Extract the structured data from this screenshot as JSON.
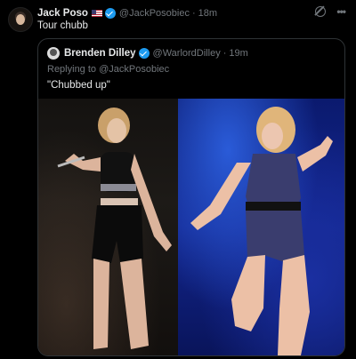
{
  "tweet": {
    "author_name": "Jack Poso",
    "author_handle": "@JackPosobiec",
    "time": "18m",
    "separator": "·",
    "text": "Tour chubb"
  },
  "quoted": {
    "author_name": "Brenden Dilley",
    "author_handle": "@WarlordDilley",
    "separator": "·",
    "time": "19m",
    "replying_prefix": "Replying to",
    "replying_handle": "@JackPosobiec",
    "text": "\"Chubbed up\""
  },
  "icons": {
    "more": "•••"
  },
  "colors": {
    "background": "#000000",
    "text_primary": "#e7e9ea",
    "text_secondary": "#71767b",
    "verified": "#1d9bf0",
    "border": "#2f3336"
  }
}
